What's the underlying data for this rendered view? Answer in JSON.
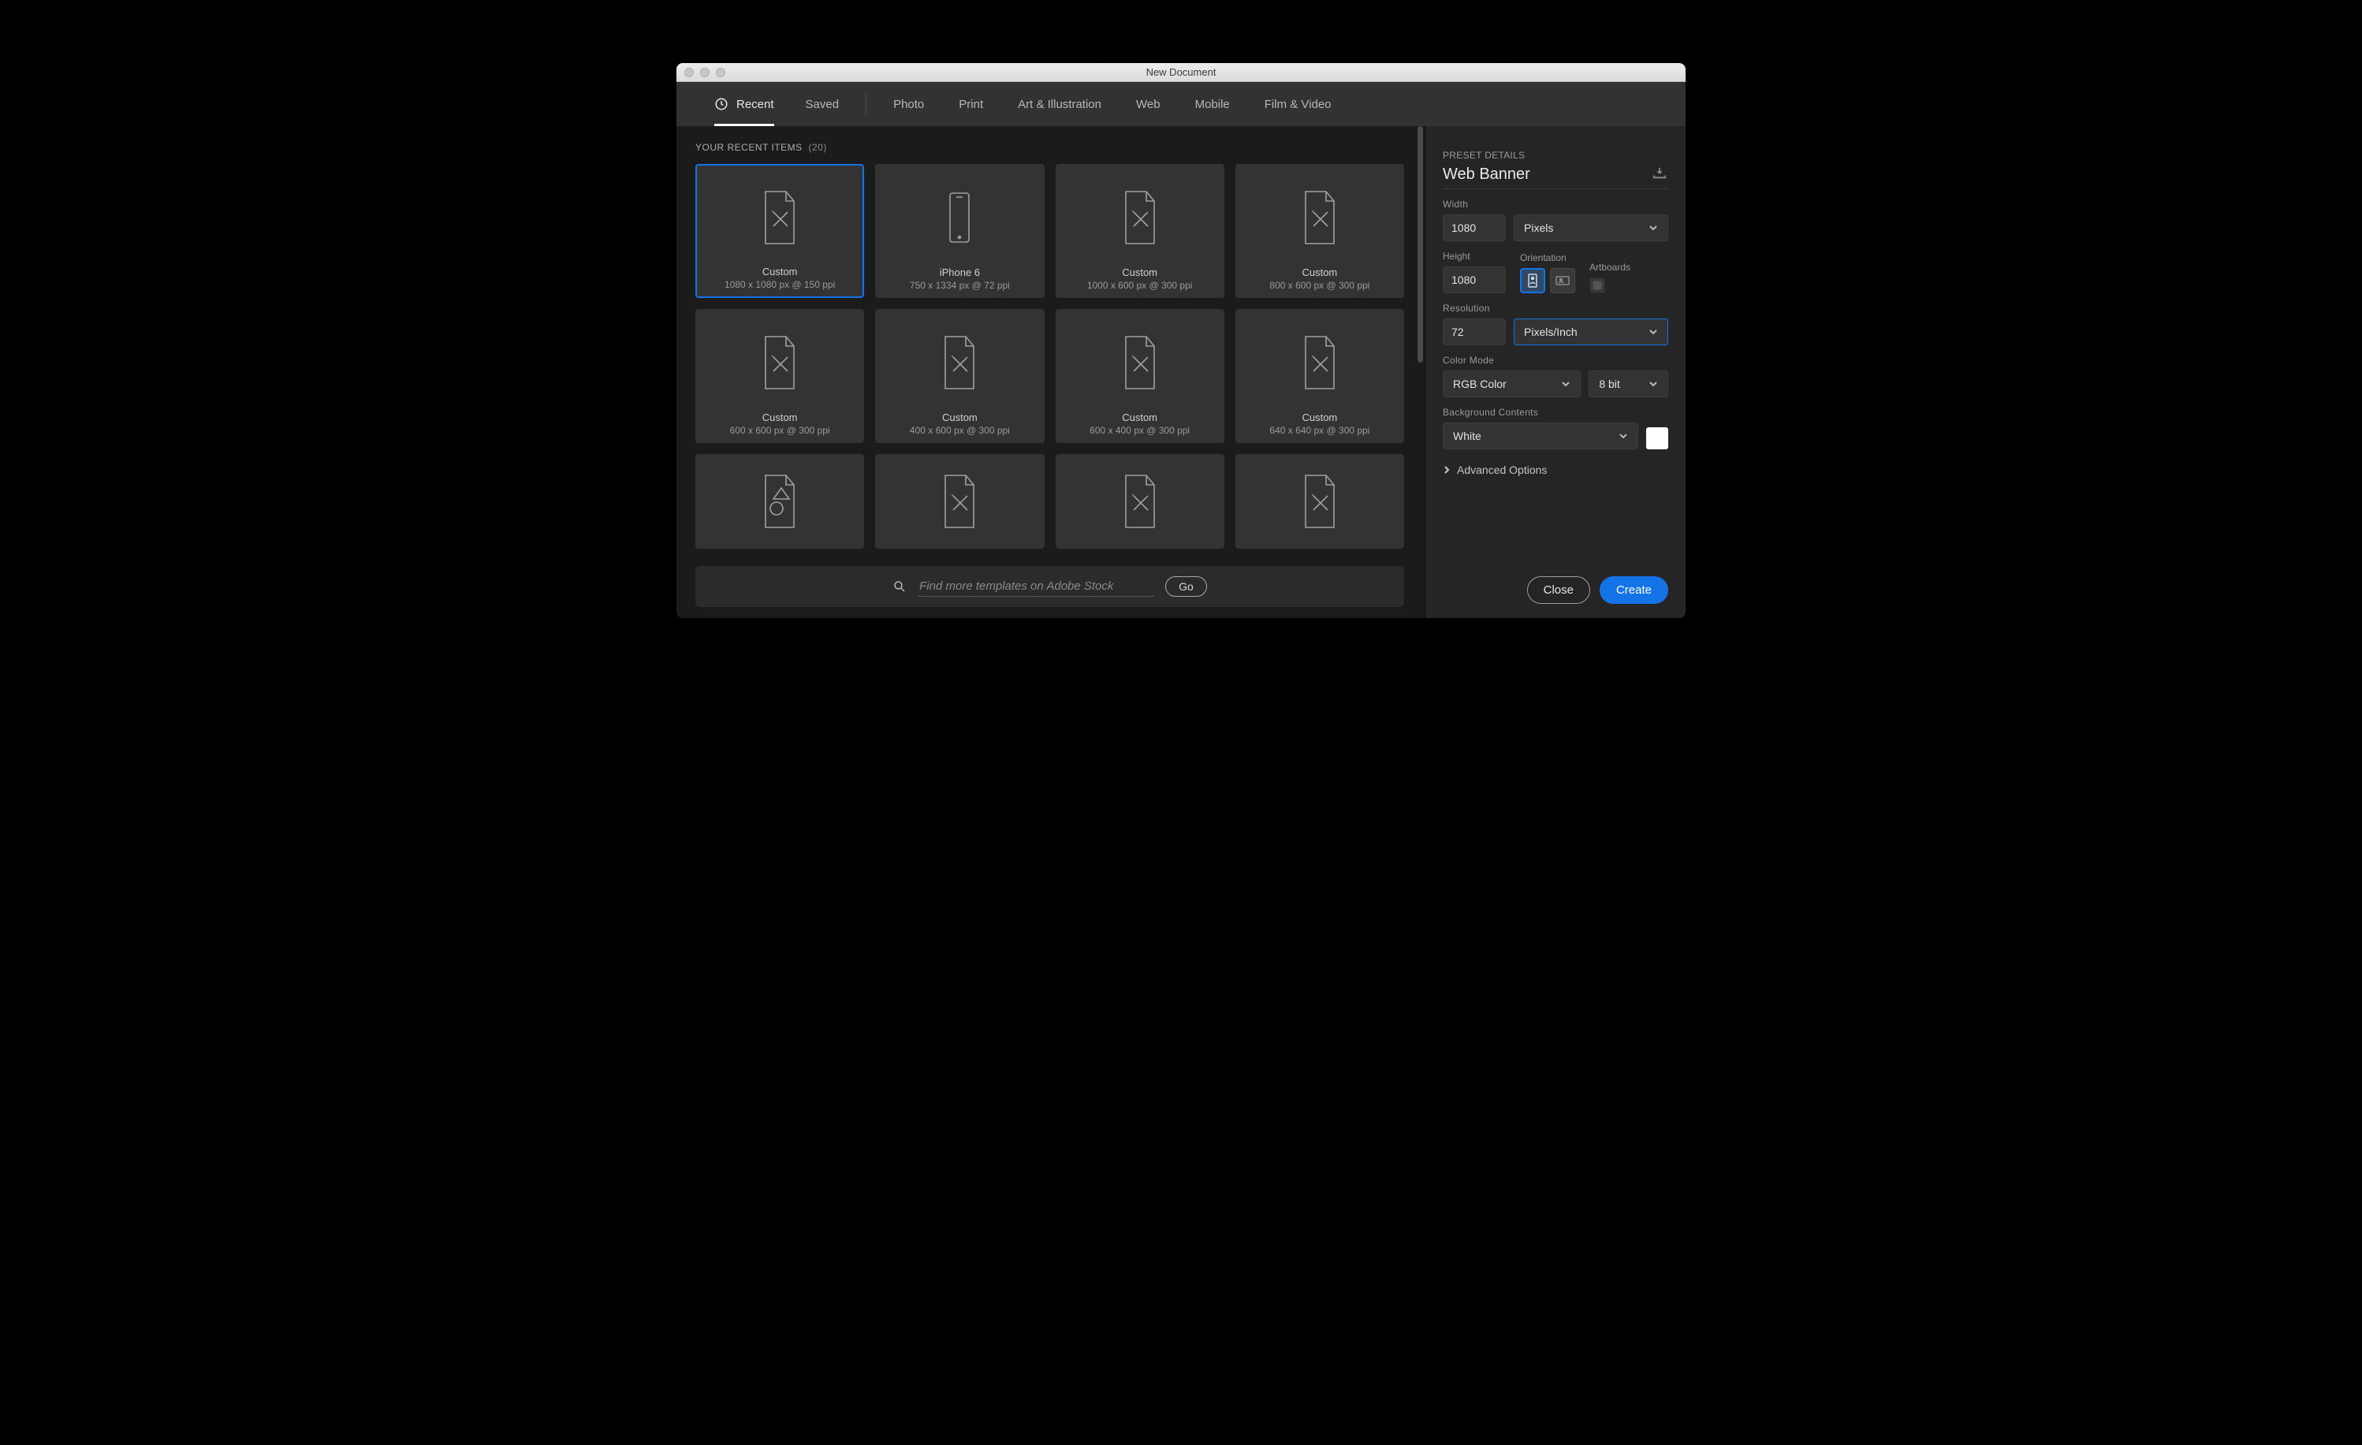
{
  "window": {
    "title": "New Document"
  },
  "tabs": {
    "recent": "Recent",
    "saved": "Saved",
    "photo": "Photo",
    "print": "Print",
    "art": "Art & Illustration",
    "web": "Web",
    "mobile": "Mobile",
    "film": "Film & Video",
    "active": "recent"
  },
  "recent": {
    "heading": "YOUR RECENT ITEMS",
    "count": "(20)",
    "items": [
      {
        "title": "Custom",
        "sub": "1080 x 1080 px @ 150 ppi",
        "icon": "doc",
        "selected": true
      },
      {
        "title": "iPhone 6",
        "sub": "750 x 1334 px @ 72 ppi",
        "icon": "phone"
      },
      {
        "title": "Custom",
        "sub": "1000 x 600 px @ 300 ppi",
        "icon": "doc"
      },
      {
        "title": "Custom",
        "sub": "800 x 600 px @ 300 ppi",
        "icon": "doc"
      },
      {
        "title": "Custom",
        "sub": "600 x 600 px @ 300 ppi",
        "icon": "doc"
      },
      {
        "title": "Custom",
        "sub": "400 x 600 px @ 300 ppi",
        "icon": "doc"
      },
      {
        "title": "Custom",
        "sub": "600 x 400 px @ 300 ppi",
        "icon": "doc"
      },
      {
        "title": "Custom",
        "sub": "640 x 640 px @ 300 ppi",
        "icon": "doc"
      },
      {
        "title": "",
        "sub": "",
        "icon": "shape",
        "truncated": true
      },
      {
        "title": "",
        "sub": "",
        "icon": "doc",
        "truncated": true
      },
      {
        "title": "",
        "sub": "",
        "icon": "doc",
        "truncated": true
      },
      {
        "title": "",
        "sub": "",
        "icon": "doc",
        "truncated": true
      }
    ]
  },
  "search": {
    "placeholder": "Find more templates on Adobe Stock",
    "go": "Go"
  },
  "details": {
    "heading": "PRESET DETAILS",
    "name": "Web Banner",
    "width_label": "Width",
    "width": "1080",
    "units": "Pixels",
    "height_label": "Height",
    "height": "1080",
    "orientation_label": "Orientation",
    "orientation": "portrait",
    "artboards_label": "Artboards",
    "artboards": false,
    "resolution_label": "Resolution",
    "resolution": "72",
    "resolution_units": "Pixels/Inch",
    "color_label": "Color Mode",
    "color_mode": "RGB Color",
    "bit_depth": "8 bit",
    "bg_label": "Background Contents",
    "bg": "White",
    "bg_color": "#ffffff",
    "advanced": "Advanced Options"
  },
  "footer": {
    "close": "Close",
    "create": "Create"
  }
}
